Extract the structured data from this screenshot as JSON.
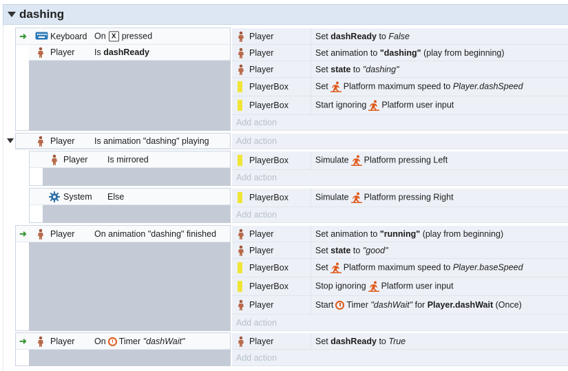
{
  "group": {
    "title": "dashing"
  },
  "ev1": {
    "conditions": [
      {
        "object": "Keyboard",
        "pre": "On",
        "key": "X",
        "post": "pressed"
      },
      {
        "object": "Player",
        "pre": "Is",
        "bold": "dashReady"
      }
    ],
    "actions": [
      {
        "object": "Player",
        "pre": "Set",
        "bold": "dashReady",
        "mid": "to",
        "ital": "False"
      },
      {
        "object": "Player",
        "pre": "Set animation to",
        "bold": "\"dashing\"",
        "post": "(play from beginning)"
      },
      {
        "object": "Player",
        "pre": "Set",
        "bold": "state",
        "mid": "to",
        "ital": "\"dashing\""
      },
      {
        "object": "PlayerBox",
        "pre": "Set",
        "beh": "Platform maximum speed to",
        "ital": "Player.dashSpeed"
      },
      {
        "object": "PlayerBox",
        "pre": "Start ignoring",
        "beh": "Platform user input"
      }
    ],
    "add_action": "Add action"
  },
  "ev2": {
    "condition": {
      "object": "Player",
      "text": "Is animation \"dashing\" playing"
    },
    "add_action": "Add action",
    "sub1": {
      "object": "Player",
      "text": "Is mirrored",
      "action": {
        "object": "PlayerBox",
        "pre": "Simulate",
        "beh": "Platform pressing Left"
      },
      "add_action": "Add action"
    },
    "sub2": {
      "object": "System",
      "text": "Else",
      "action": {
        "object": "PlayerBox",
        "pre": "Simulate",
        "beh": "Platform pressing Right"
      },
      "add_action": "Add action"
    }
  },
  "ev3": {
    "condition": {
      "object": "Player",
      "text": "On animation \"dashing\" finished"
    },
    "actions": [
      {
        "object": "Player",
        "pre": "Set animation to",
        "bold": "\"running\"",
        "post": "(play from beginning)"
      },
      {
        "object": "Player",
        "pre": "Set",
        "bold": "state",
        "mid": "to",
        "ital": "\"good\""
      },
      {
        "object": "PlayerBox",
        "pre": "Set",
        "beh": "Platform maximum speed to",
        "ital": "Player.baseSpeed"
      },
      {
        "object": "PlayerBox",
        "pre": "Stop ignoring",
        "beh": "Platform user input"
      },
      {
        "object": "Player",
        "pre": "Start",
        "timer": "Timer",
        "ital": "\"dashWait\"",
        "mid": "for",
        "bold": "Player.dashWait",
        "post": "(Once)"
      }
    ],
    "add_action": "Add action"
  },
  "ev4": {
    "condition": {
      "object": "Player",
      "pre": "On",
      "timer": "Timer",
      "ital": "\"dashWait\""
    },
    "action": {
      "object": "Player",
      "pre": "Set",
      "bold": "dashReady",
      "mid": "to",
      "ital": "True"
    },
    "add_action": "Add action"
  },
  "colors": {
    "accent_icon": "#e05a1a",
    "family_bar": "#f0e535",
    "gutter": "#c4cbd6",
    "header": "#dde7f4"
  }
}
